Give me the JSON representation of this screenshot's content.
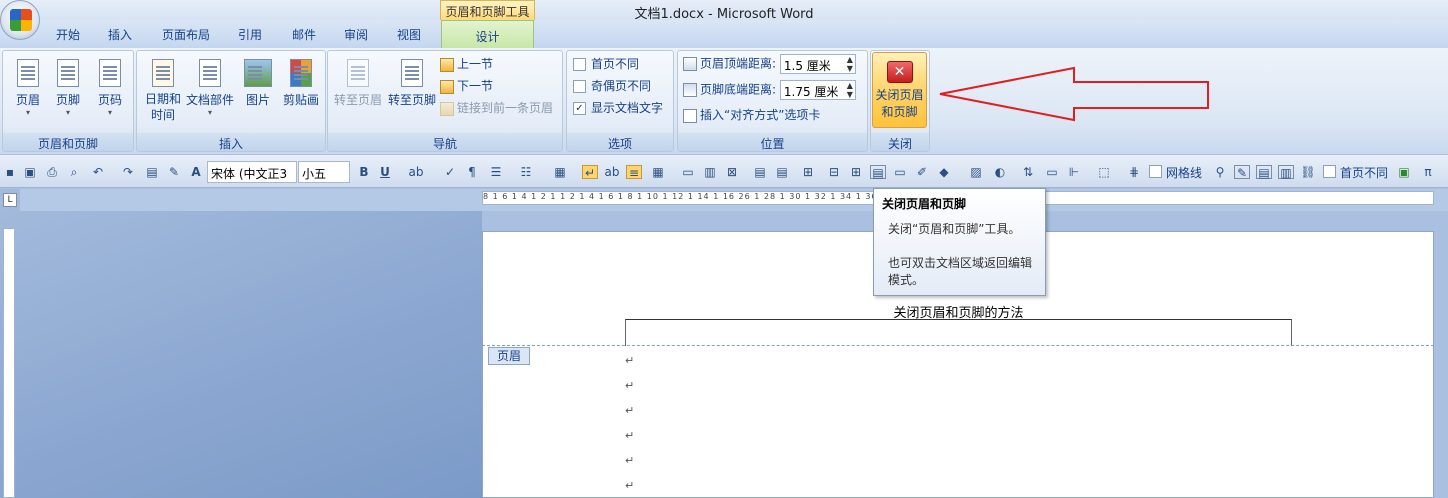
{
  "window": {
    "title": "文档1.docx - Microsoft Word"
  },
  "contextual_tab": "页眉和页脚工具",
  "tabs": [
    "开始",
    "插入",
    "页面布局",
    "引用",
    "邮件",
    "审阅",
    "视图"
  ],
  "active_tab": "设计",
  "ribbon": {
    "group_header_footer": {
      "label": "页眉和页脚",
      "buttons": [
        "页眉",
        "页脚",
        "页码"
      ]
    },
    "group_insert": {
      "label": "插入",
      "date_time": "日期和\n时间",
      "doc_parts": "文档部件",
      "picture": "图片",
      "clipart": "剪贴画"
    },
    "group_nav": {
      "label": "导航",
      "goto_header": "转至页眉",
      "goto_footer": "转至页脚",
      "prev": "上一节",
      "next": "下一节",
      "link_prev": "链接到前一条页眉"
    },
    "group_options": {
      "label": "选项",
      "first_page": "首页不同",
      "odd_even": "奇偶页不同",
      "show_text": "显示文档文字"
    },
    "group_position": {
      "label": "位置",
      "header_top_label": "页眉顶端距离:",
      "header_top_value": "1.5 厘米",
      "footer_bottom_label": "页脚底端距离:",
      "footer_bottom_value": "1.75 厘米",
      "insert_align_tab": "插入“对齐方式”选项卡"
    },
    "group_close": {
      "label": "关闭",
      "close_line1": "关闭页眉",
      "close_line2": "和页脚"
    }
  },
  "qat": {
    "font_name": "宋体 (中文正3",
    "font_size": "小五",
    "gridlines": "网格线",
    "first_page": "首页不同"
  },
  "ruler": {
    "marks": "8 1 6 1 4 1 2 1  1 2 1 4 1 6 1 8 1 10 1 12 1 14 1 16     26 1 28 1 30 1 32 1 34 1 36 1 38 1 40 1 42 1 44 1 46 1 48"
  },
  "document": {
    "header_text": "关闭页眉和页脚的方法",
    "header_tag": "页眉"
  },
  "tooltip": {
    "title": "关闭页眉和页脚",
    "line1": "关闭“页眉和页脚”工具。",
    "line2": "也可双击文档区域返回编辑模式。"
  },
  "colors": {
    "arrow": "#e02020",
    "ribbon_text": "#15428b",
    "active_tab": "#c8e6a8"
  }
}
